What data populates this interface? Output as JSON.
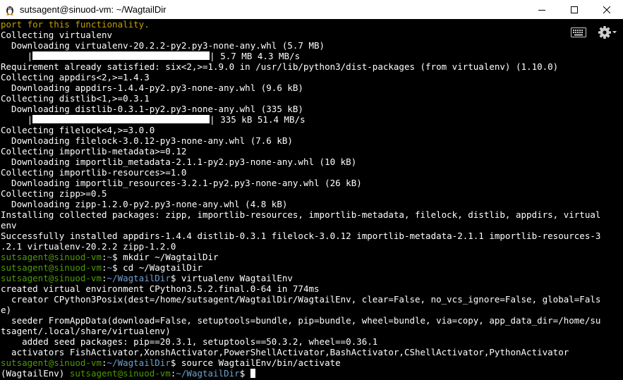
{
  "window": {
    "title": "sutsagent@sinuod-vm: ~/WagtailDir",
    "app_icon": "tux-icon",
    "controls": [
      "minimize-icon",
      "maximize-icon",
      "close-icon"
    ]
  },
  "toolbar": {
    "icons": [
      "keyboard-icon",
      "gear-icon"
    ]
  },
  "terminal": {
    "lines": [
      {
        "segments": [
          {
            "t": "port for this functionality.",
            "c": "orange"
          }
        ]
      },
      {
        "segments": [
          {
            "t": "Collecting virtualenv"
          }
        ]
      },
      {
        "segments": [
          {
            "t": "  Downloading virtualenv-20.2.2-py2.py3-none-any.whl (5.7 MB)"
          }
        ]
      },
      {
        "segments": [
          {
            "t": "     |"
          },
          {
            "bar": true
          },
          {
            "t": "| 5.7 MB 4.3 MB/s"
          }
        ]
      },
      {
        "segments": [
          {
            "t": "Requirement already satisfied: six<2,>=1.9.0 in /usr/lib/python3/dist-packages (from virtualenv) (1.10.0)"
          }
        ]
      },
      {
        "segments": [
          {
            "t": "Collecting appdirs<2,>=1.4.3"
          }
        ]
      },
      {
        "segments": [
          {
            "t": "  Downloading appdirs-1.4.4-py2.py3-none-any.whl (9.6 kB)"
          }
        ]
      },
      {
        "segments": [
          {
            "t": "Collecting distlib<1,>=0.3.1"
          }
        ]
      },
      {
        "segments": [
          {
            "t": "  Downloading distlib-0.3.1-py2.py3-none-any.whl (335 kB)"
          }
        ]
      },
      {
        "segments": [
          {
            "t": "     |"
          },
          {
            "bar": true
          },
          {
            "t": "| 335 kB 51.4 MB/s"
          }
        ]
      },
      {
        "segments": [
          {
            "t": "Collecting filelock<4,>=3.0.0"
          }
        ]
      },
      {
        "segments": [
          {
            "t": "  Downloading filelock-3.0.12-py3-none-any.whl (7.6 kB)"
          }
        ]
      },
      {
        "segments": [
          {
            "t": "Collecting importlib-metadata>=0.12"
          }
        ]
      },
      {
        "segments": [
          {
            "t": "  Downloading importlib_metadata-2.1.1-py2.py3-none-any.whl (10 kB)"
          }
        ]
      },
      {
        "segments": [
          {
            "t": "Collecting importlib-resources>=1.0"
          }
        ]
      },
      {
        "segments": [
          {
            "t": "  Downloading importlib_resources-3.2.1-py2.py3-none-any.whl (26 kB)"
          }
        ]
      },
      {
        "segments": [
          {
            "t": "Collecting zipp>=0.5"
          }
        ]
      },
      {
        "segments": [
          {
            "t": "  Downloading zipp-1.2.0-py2.py3-none-any.whl (4.8 kB)"
          }
        ]
      },
      {
        "segments": [
          {
            "t": "Installing collected packages: zipp, importlib-resources, importlib-metadata, filelock, distlib, appdirs, virtual"
          }
        ]
      },
      {
        "segments": [
          {
            "t": "env"
          }
        ]
      },
      {
        "segments": [
          {
            "t": "Successfully installed appdirs-1.4.4 distlib-0.3.1 filelock-3.0.12 importlib-metadata-2.1.1 importlib-resources-3"
          }
        ]
      },
      {
        "segments": [
          {
            "t": ".2.1 virtualenv-20.2.2 zipp-1.2.0"
          }
        ]
      },
      {
        "segments": [
          {
            "t": "sutsagent@sinuod-vm",
            "c": "green"
          },
          {
            "t": ":"
          },
          {
            "t": "~",
            "c": "blue"
          },
          {
            "t": "$ mkdir ~/WagtailDir"
          }
        ]
      },
      {
        "segments": [
          {
            "t": "sutsagent@sinuod-vm",
            "c": "green"
          },
          {
            "t": ":"
          },
          {
            "t": "~",
            "c": "blue"
          },
          {
            "t": "$ cd ~/WagtailDir"
          }
        ]
      },
      {
        "segments": [
          {
            "t": "sutsagent@sinuod-vm",
            "c": "green"
          },
          {
            "t": ":"
          },
          {
            "t": "~/WagtailDir",
            "c": "blue"
          },
          {
            "t": "$ virtualenv WagtailEnv"
          }
        ]
      },
      {
        "segments": [
          {
            "t": "created virtual environment CPython3.5.2.final.0-64 in 774ms"
          }
        ]
      },
      {
        "segments": [
          {
            "t": "  creator CPython3Posix(dest=/home/sutsagent/WagtailDir/WagtailEnv, clear=False, no_vcs_ignore=False, global=Fals"
          }
        ]
      },
      {
        "segments": [
          {
            "t": "e)"
          }
        ]
      },
      {
        "segments": [
          {
            "t": "  seeder FromAppData(download=False, setuptools=bundle, pip=bundle, wheel=bundle, via=copy, app_data_dir=/home/su"
          }
        ]
      },
      {
        "segments": [
          {
            "t": "tsagent/.local/share/virtualenv)"
          }
        ]
      },
      {
        "segments": [
          {
            "t": "    added seed packages: pip==20.3.1, setuptools==50.3.2, wheel==0.36.1"
          }
        ]
      },
      {
        "segments": [
          {
            "t": "  activators FishActivator,XonshActivator,PowerShellActivator,BashActivator,CShellActivator,PythonActivator"
          }
        ]
      },
      {
        "segments": [
          {
            "t": "sutsagent@sinuod-vm",
            "c": "green"
          },
          {
            "t": ":"
          },
          {
            "t": "~/WagtailDir",
            "c": "blue"
          },
          {
            "t": "$ source WagtailEnv/bin/activate"
          }
        ]
      },
      {
        "segments": [
          {
            "t": "(WagtailEnv) "
          },
          {
            "t": "sutsagent@sinuod-vm",
            "c": "green"
          },
          {
            "t": ":"
          },
          {
            "t": "~/WagtailDir",
            "c": "blue"
          },
          {
            "t": "$ "
          },
          {
            "cursor": true
          }
        ]
      }
    ]
  }
}
